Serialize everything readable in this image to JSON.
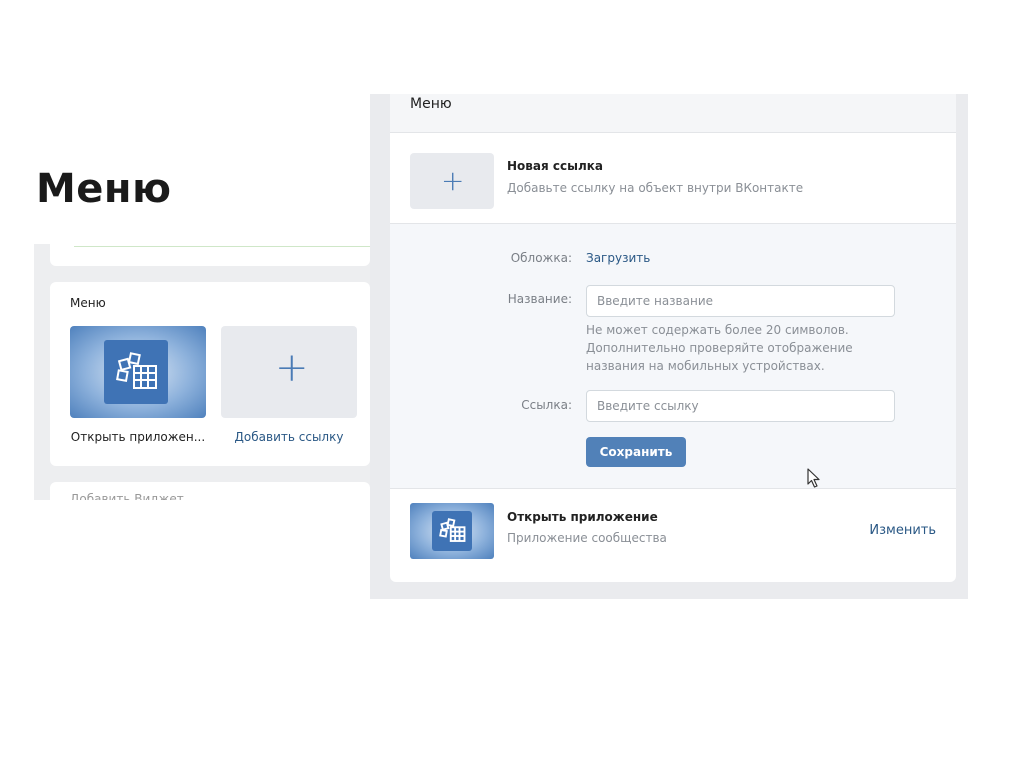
{
  "slide_title": "Меню",
  "left_panel": {
    "card_label": "Меню",
    "app_tile_caption": "Открыть приложен...",
    "add_tile_caption": "Добавить ссылку",
    "bottom_faded_text": "Добавить Виджет"
  },
  "right_panel": {
    "header": "Меню",
    "new_link": {
      "title": "Новая ссылка",
      "subtitle": "Добавьте ссылку на объект внутри ВКонтакте"
    },
    "form": {
      "cover_label": "Обложка:",
      "upload_link": "Загрузить",
      "name_label": "Название:",
      "name_placeholder": "Введите название",
      "name_value": "",
      "hint": "Не может содержать более 20 символов. Дополнительно проверяйте отображение названия на мобильных устройствах.",
      "link_label": "Ссылка:",
      "link_placeholder": "Введите ссылку",
      "link_value": "",
      "save_button": "Сохранить"
    },
    "app_item": {
      "title": "Открыть приложение",
      "subtitle": "Приложение сообщества",
      "edit_link": "Изменить"
    }
  },
  "icons": [
    "plus-icon",
    "apps-grid-icon",
    "mouse-cursor-icon"
  ],
  "colors": {
    "accent": "#5181b8",
    "link": "#2a5885",
    "panel_bg": "#edeef0",
    "muted_text": "#8a8f96"
  }
}
